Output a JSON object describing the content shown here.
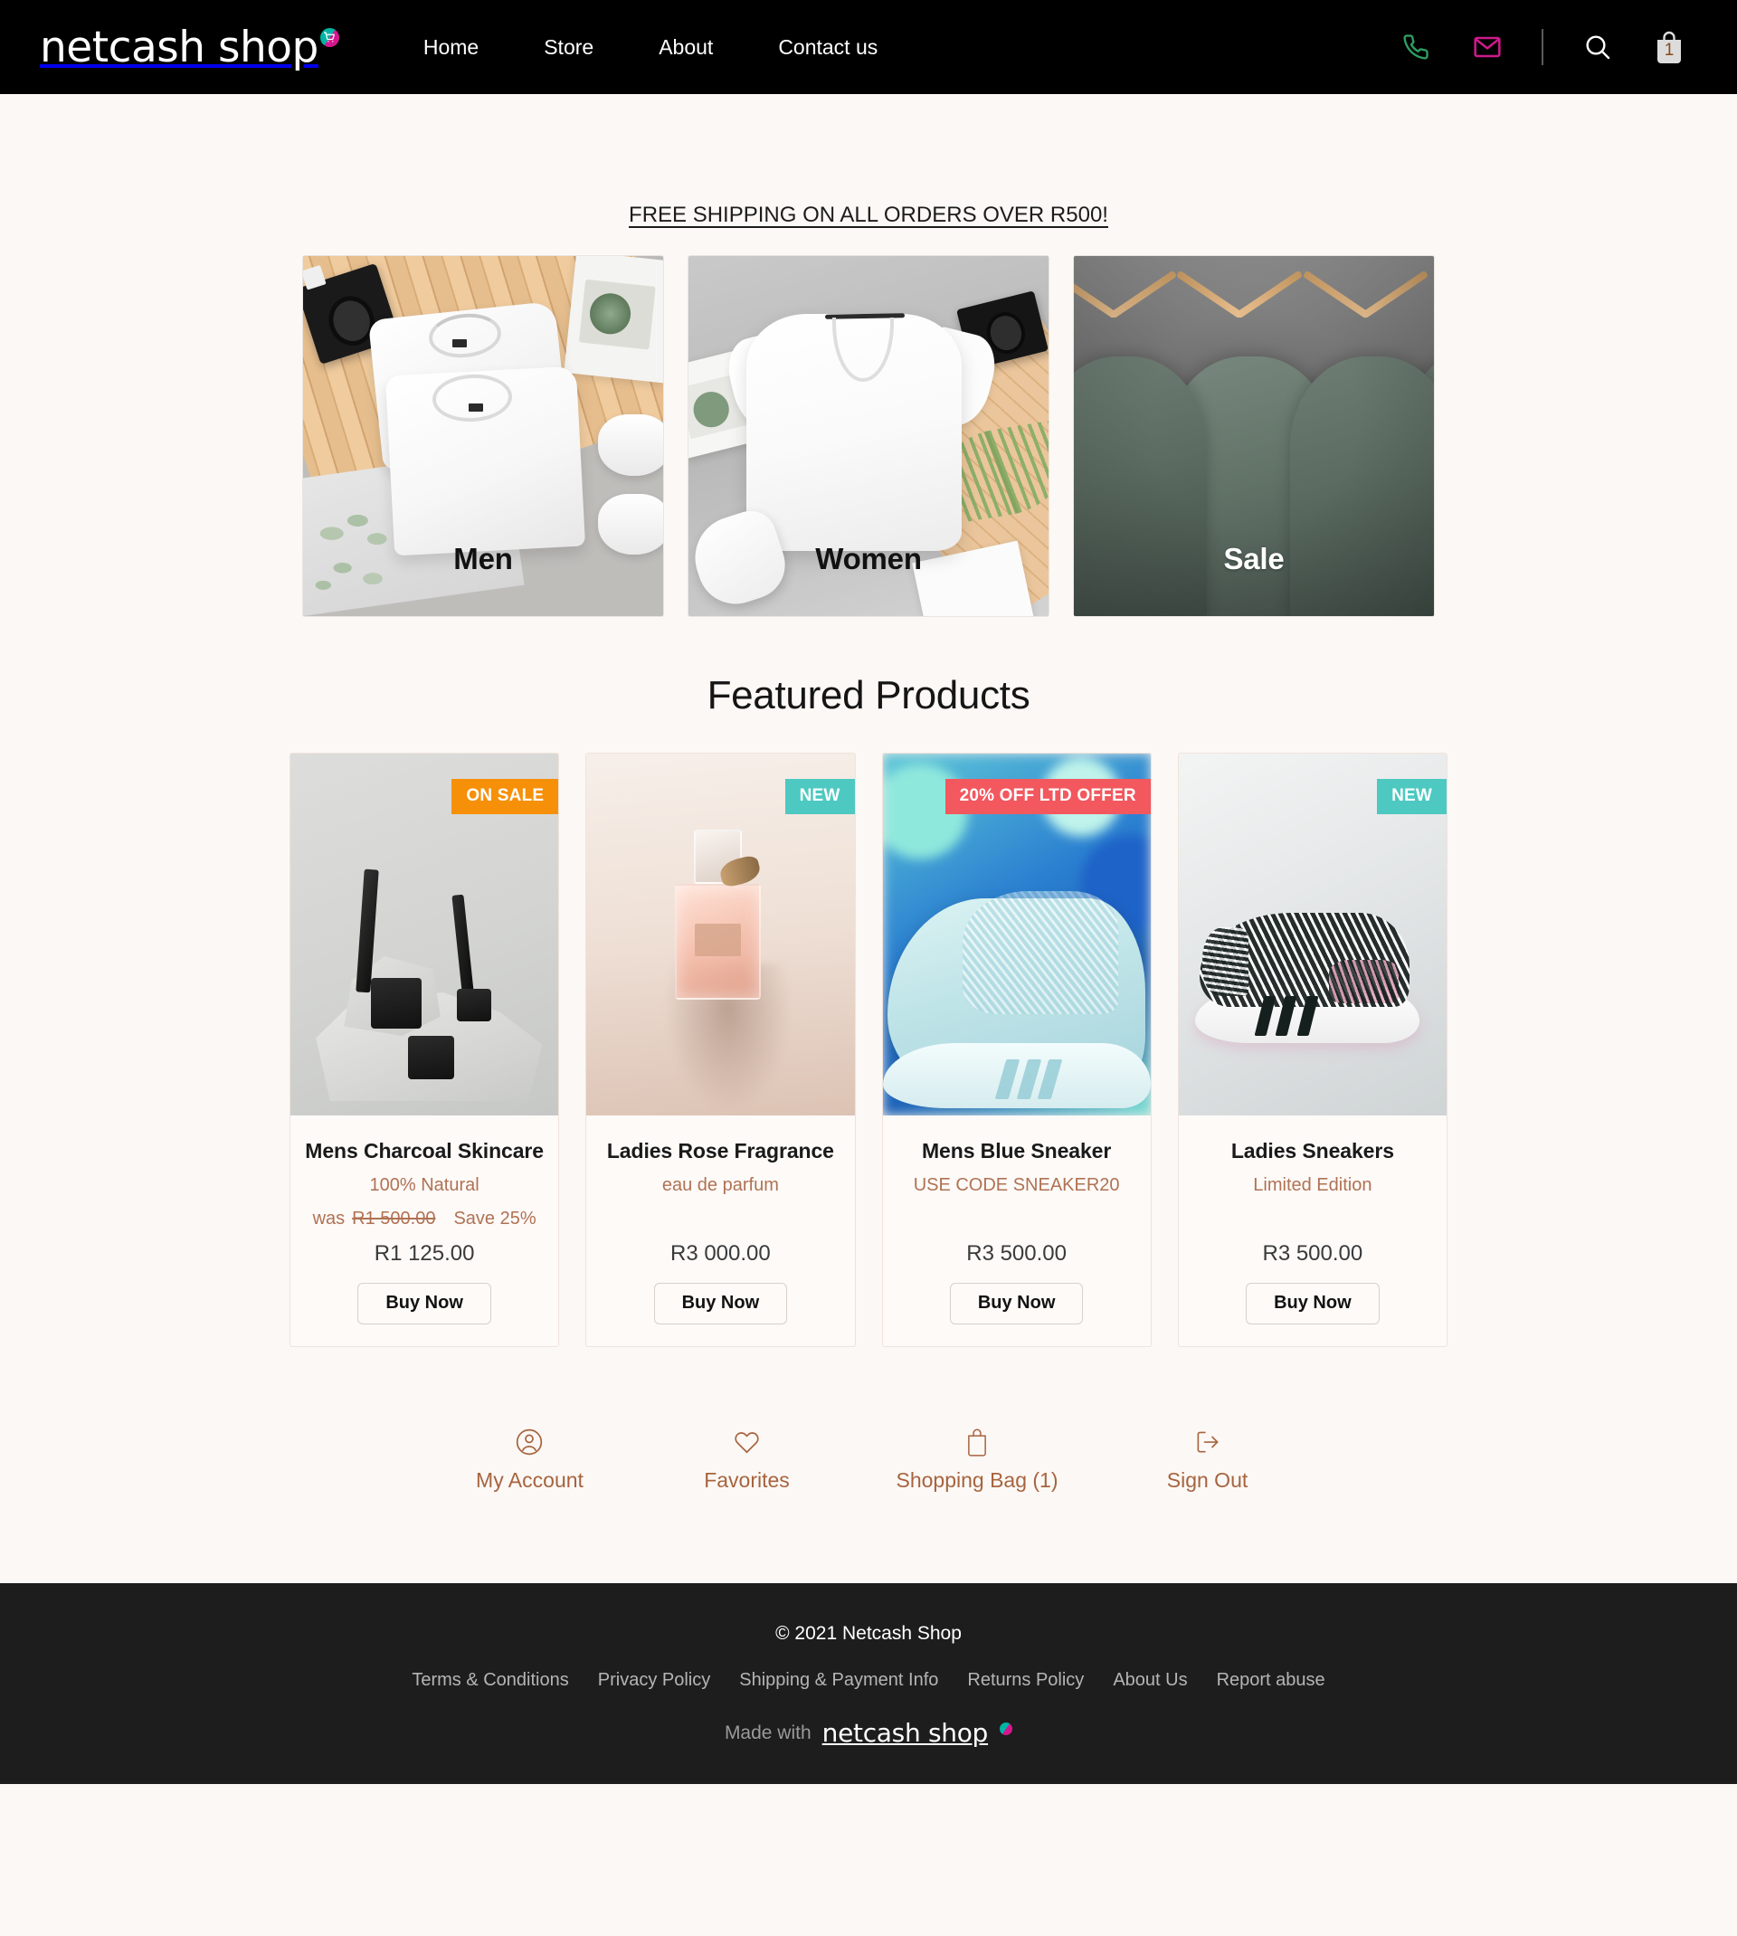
{
  "header": {
    "logo_text": "netcash shop",
    "logo_badge_icon": "shopping-cart-icon",
    "nav": [
      {
        "label": "Home"
      },
      {
        "label": "Store"
      },
      {
        "label": "About"
      },
      {
        "label": "Contact us"
      }
    ],
    "icons": {
      "phone": "phone-icon",
      "mail": "envelope-icon",
      "search": "search-icon",
      "bag": "shopping-bag-icon"
    },
    "cart_count": "1",
    "colors": {
      "background": "#000000",
      "phone": "#2E9E62",
      "mail": "#CE1A8A",
      "bag_count": "#8A4A16"
    }
  },
  "main": {
    "shipping_banner": "FREE SHIPPING ON ALL ORDERS OVER R500!",
    "categories": [
      {
        "label": "Men",
        "label_color": "dark",
        "image": "folded-white-tshirts-on-wood-flatlay"
      },
      {
        "label": "Women",
        "label_color": "dark",
        "image": "white-vneck-tshirt-flatlay"
      },
      {
        "label": "Sale",
        "label_color": "light",
        "image": "green-tshirts-on-wooden-hangers"
      }
    ],
    "featured_title": "Featured Products",
    "products": [
      {
        "name": "Mens Charcoal Skincare",
        "subtitle": "100% Natural",
        "was_label": "was",
        "was_price": "R1 500.00",
        "save_text": "Save 25%",
        "price": "R1 125.00",
        "buy_label": "Buy Now",
        "badge": {
          "text": "ON SALE",
          "style": "onsale",
          "color": "#F79009"
        },
        "image": "black-charcoal-skincare-jars-on-stone"
      },
      {
        "name": "Ladies Rose Fragrance",
        "subtitle": "eau de parfum",
        "was_label": "",
        "was_price": "",
        "save_text": "",
        "price": "R3 000.00",
        "buy_label": "Buy Now",
        "badge": {
          "text": "NEW",
          "style": "new",
          "color": "#4DC9C1"
        },
        "image": "pink-glass-perfume-bottle"
      },
      {
        "name": "Mens Blue Sneaker",
        "subtitle": "USE CODE SNEAKER20",
        "was_label": "",
        "was_price": "",
        "save_text": "",
        "price": "R3 500.00",
        "buy_label": "Buy Now",
        "badge": {
          "text": "20% OFF LTD OFFER",
          "style": "ltd",
          "color": "#F2585E"
        },
        "image": "light-blue-knit-sneaker"
      },
      {
        "name": "Ladies Sneakers",
        "subtitle": "Limited Edition",
        "was_label": "",
        "was_price": "",
        "save_text": "",
        "price": "R3 500.00",
        "buy_label": "Buy Now",
        "badge": {
          "text": "NEW",
          "style": "new",
          "color": "#4DC9C1"
        },
        "image": "black-white-knit-sneaker-pink-accent"
      }
    ],
    "account_links": [
      {
        "label": "My Account",
        "icon": "user-circle-icon"
      },
      {
        "label": "Favorites",
        "icon": "heart-icon"
      },
      {
        "label": "Shopping Bag (1)",
        "icon": "shopping-bag-icon"
      },
      {
        "label": "Sign Out",
        "icon": "sign-out-icon"
      }
    ],
    "accent_color": "#A6643F"
  },
  "footer": {
    "copyright": "© 2021 Netcash Shop",
    "links": [
      {
        "label": "Terms & Conditions"
      },
      {
        "label": "Privacy Policy"
      },
      {
        "label": "Shipping & Payment Info"
      },
      {
        "label": "Returns Policy"
      },
      {
        "label": "About Us"
      },
      {
        "label": "Report abuse"
      }
    ],
    "made_with_text": "Made with",
    "made_with_logo": "netcash shop",
    "background": "#1D1D1D"
  }
}
